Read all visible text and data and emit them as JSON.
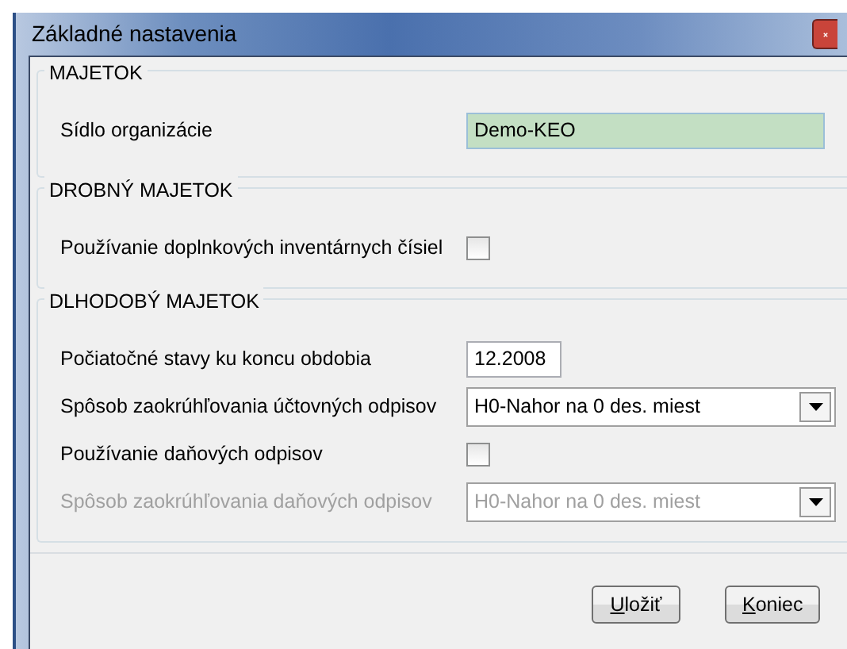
{
  "window": {
    "title": "Základné nastavenia"
  },
  "groups": [
    {
      "title": "MAJETOK",
      "rows": [
        {
          "kind": "text",
          "label": "Sídlo organizácie",
          "value": "Demo-KEO",
          "highlighted": true,
          "disabled": false
        }
      ]
    },
    {
      "title": "DROBNÝ MAJETOK",
      "rows": [
        {
          "kind": "checkbox",
          "label": "Používanie doplnkových inventárnych čísiel",
          "checked": false,
          "disabled": false
        }
      ]
    },
    {
      "title": "DLHODOBÝ MAJETOK",
      "rows": [
        {
          "kind": "text",
          "label": "Počiatočné stavy ku koncu obdobia",
          "value": "12.2008",
          "highlighted": false,
          "disabled": false
        },
        {
          "kind": "select",
          "label": "Spôsob zaokrúhľovania účtovných odpisov",
          "value": "H0-Nahor na 0 des. miest",
          "disabled": false
        },
        {
          "kind": "checkbox",
          "label": "Používanie daňových odpisov",
          "checked": false,
          "disabled": false
        },
        {
          "kind": "select",
          "label": "Spôsob zaokrúhľovania daňových odpisov",
          "value": "H0-Nahor na 0 des. miest",
          "disabled": true
        }
      ]
    }
  ],
  "buttons": [
    {
      "label": "Uložiť",
      "mnemonic_first": true
    },
    {
      "label": "Koniec",
      "mnemonic_first": true
    }
  ]
}
